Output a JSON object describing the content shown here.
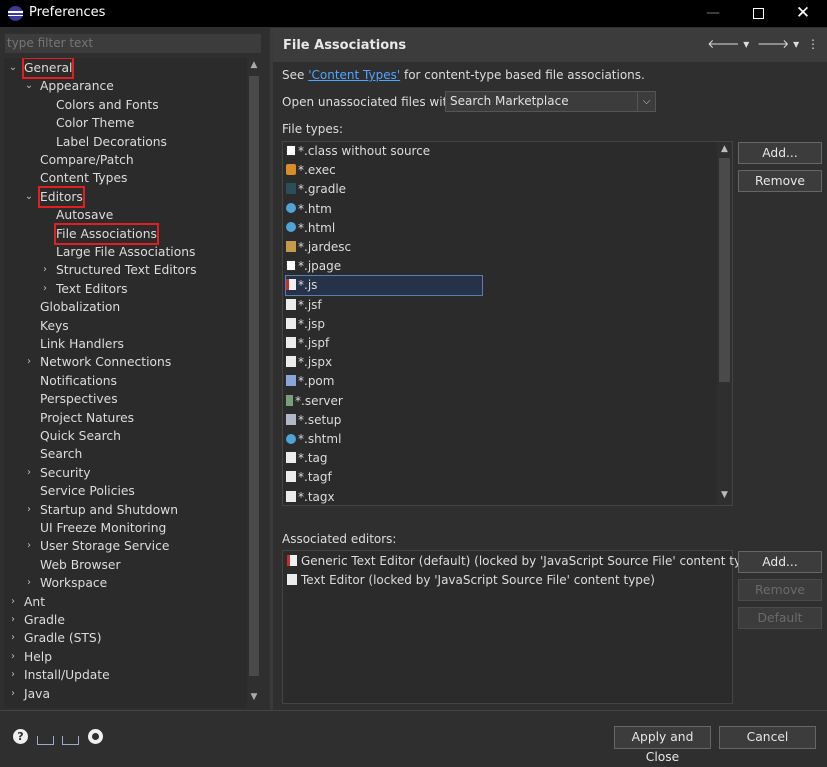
{
  "window": {
    "title": "Preferences",
    "minimize": "—",
    "close": "✕"
  },
  "filter": {
    "placeholder": "type filter text"
  },
  "tree": {
    "items": [
      {
        "label": "General",
        "expanded": true,
        "highlighted": true
      },
      {
        "label": "Appearance",
        "expanded": true
      },
      {
        "label": "Colors and Fonts"
      },
      {
        "label": "Color Theme"
      },
      {
        "label": "Label Decorations"
      },
      {
        "label": "Compare/Patch"
      },
      {
        "label": "Content Types"
      },
      {
        "label": "Editors",
        "expanded": true,
        "highlighted": true
      },
      {
        "label": "Autosave"
      },
      {
        "label": "File Associations",
        "highlighted": true,
        "selected": true
      },
      {
        "label": "Large File Associations"
      },
      {
        "label": "Structured Text Editors",
        "collapsed": true
      },
      {
        "label": "Text Editors",
        "collapsed": true
      },
      {
        "label": "Globalization"
      },
      {
        "label": "Keys"
      },
      {
        "label": "Link Handlers"
      },
      {
        "label": "Network Connections",
        "collapsed": true
      },
      {
        "label": "Notifications"
      },
      {
        "label": "Perspectives"
      },
      {
        "label": "Project Natures"
      },
      {
        "label": "Quick Search"
      },
      {
        "label": "Search"
      },
      {
        "label": "Security",
        "collapsed": true
      },
      {
        "label": "Service Policies"
      },
      {
        "label": "Startup and Shutdown",
        "collapsed": true
      },
      {
        "label": "UI Freeze Monitoring"
      },
      {
        "label": "User Storage Service",
        "collapsed": true
      },
      {
        "label": "Web Browser"
      },
      {
        "label": "Workspace",
        "collapsed": true
      },
      {
        "label": "Ant",
        "collapsed": true
      },
      {
        "label": "Gradle",
        "collapsed": true
      },
      {
        "label": "Gradle (STS)",
        "collapsed": true
      },
      {
        "label": "Help",
        "collapsed": true
      },
      {
        "label": "Install/Update",
        "collapsed": true
      },
      {
        "label": "Java",
        "collapsed": true
      }
    ]
  },
  "page": {
    "title": "File Associations",
    "intro_before": "See ",
    "intro_link": "'Content Types'",
    "intro_after": " for content-type based file associations.",
    "open_unassoc_label": "Open unassociated files with:",
    "open_unassoc_value": "Search Marketplace",
    "file_types_label": "File types:",
    "file_types": [
      {
        "name": "*.class without source",
        "icon": "java"
      },
      {
        "name": "*.exec",
        "icon": "gear"
      },
      {
        "name": "*.gradle",
        "icon": "grad"
      },
      {
        "name": "*.htm",
        "icon": "globe"
      },
      {
        "name": "*.html",
        "icon": "globe"
      },
      {
        "name": "*.jardesc",
        "icon": "jar"
      },
      {
        "name": "*.jpage",
        "icon": "java"
      },
      {
        "name": "*.js",
        "icon": "js",
        "selected": true
      },
      {
        "name": "*.jsf",
        "icon": "doc"
      },
      {
        "name": "*.jsp",
        "icon": "doc"
      },
      {
        "name": "*.jspf",
        "icon": "doc"
      },
      {
        "name": "*.jspx",
        "icon": "doc"
      },
      {
        "name": "*.pom",
        "icon": "pom"
      },
      {
        "name": "*.server",
        "icon": "srv"
      },
      {
        "name": "*.setup",
        "icon": "setup"
      },
      {
        "name": "*.shtml",
        "icon": "globe"
      },
      {
        "name": "*.tag",
        "icon": "doc"
      },
      {
        "name": "*.tagf",
        "icon": "doc"
      },
      {
        "name": "*.tagx",
        "icon": "doc"
      }
    ],
    "add_label": "Add...",
    "remove_label": "Remove",
    "assoc_editors_label": "Associated editors:",
    "assoc_editors": [
      {
        "name": "Generic Text Editor (default) (locked by 'JavaScript Source File' content type)",
        "icon": "js"
      },
      {
        "name": "Text Editor (locked by 'JavaScript Source File' content type)",
        "icon": "doc"
      }
    ],
    "editor_add_label": "Add...",
    "editor_remove_label": "Remove",
    "editor_default_label": "Default"
  },
  "footer": {
    "apply_close_label": "Apply and Close",
    "cancel_label": "Cancel",
    "help_glyph": "?"
  }
}
